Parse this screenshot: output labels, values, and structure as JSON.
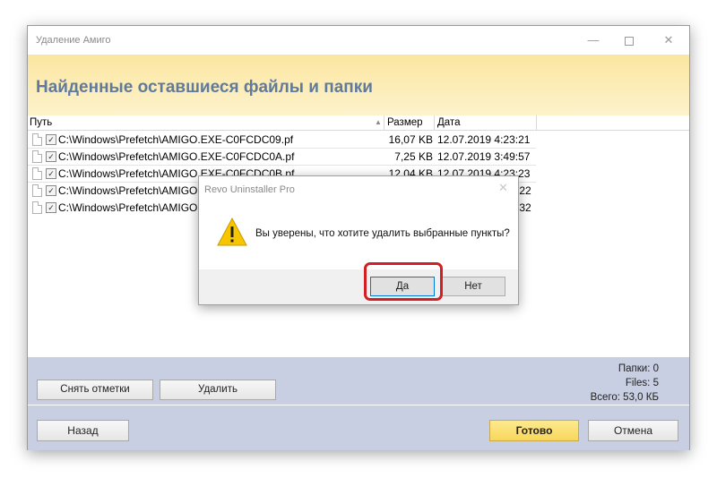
{
  "window": {
    "title": "Удаление Амиго",
    "heading": "Найденные оставшиеся файлы и папки"
  },
  "list": {
    "columns": {
      "path": "Путь",
      "size": "Размер",
      "date": "Дата"
    },
    "rows": [
      {
        "path": "C:\\Windows\\Prefetch\\AMIGO.EXE-C0FCDC09.pf",
        "size": "16,07 KB",
        "date": "12.07.2019  4:23:21",
        "checked": true
      },
      {
        "path": "C:\\Windows\\Prefetch\\AMIGO.EXE-C0FCDC0A.pf",
        "size": "7,25 KB",
        "date": "12.07.2019  3:49:57",
        "checked": true
      },
      {
        "path": "C:\\Windows\\Prefetch\\AMIGO.EXE-C0FCDC0B.pf",
        "size": "12,04 KB",
        "date": "12.07.2019  4:23:23",
        "checked": true
      },
      {
        "path": "C:\\Windows\\Prefetch\\AMIGO",
        "size": "",
        "date": ":22",
        "checked": true
      },
      {
        "path": "C:\\Windows\\Prefetch\\AMIGO",
        "size": "",
        "date": ":32",
        "checked": true
      }
    ]
  },
  "actions": {
    "uncheck_label": "Снять отметки",
    "delete_label": "Удалить"
  },
  "stats": {
    "folders_label": "Папки:",
    "folders_value": "0",
    "files_label": "Files:",
    "files_value": "5",
    "total_label": "Всего:",
    "total_value": "53,0 КБ"
  },
  "footer": {
    "back_label": "Назад",
    "done_label": "Готово",
    "cancel_label": "Отмена"
  },
  "dialog": {
    "title": "Revo Uninstaller Pro",
    "message": "Вы уверены, что хотите удалить выбранные пункты?",
    "yes_label": "Да",
    "no_label": "Нет",
    "icon": "warning-icon"
  },
  "colors": {
    "banner": "#fbe6a0",
    "heading": "#5f7a9c",
    "panel": "#c9cfe2",
    "done_button": "#f8d75a",
    "highlight": "#d11f25"
  }
}
